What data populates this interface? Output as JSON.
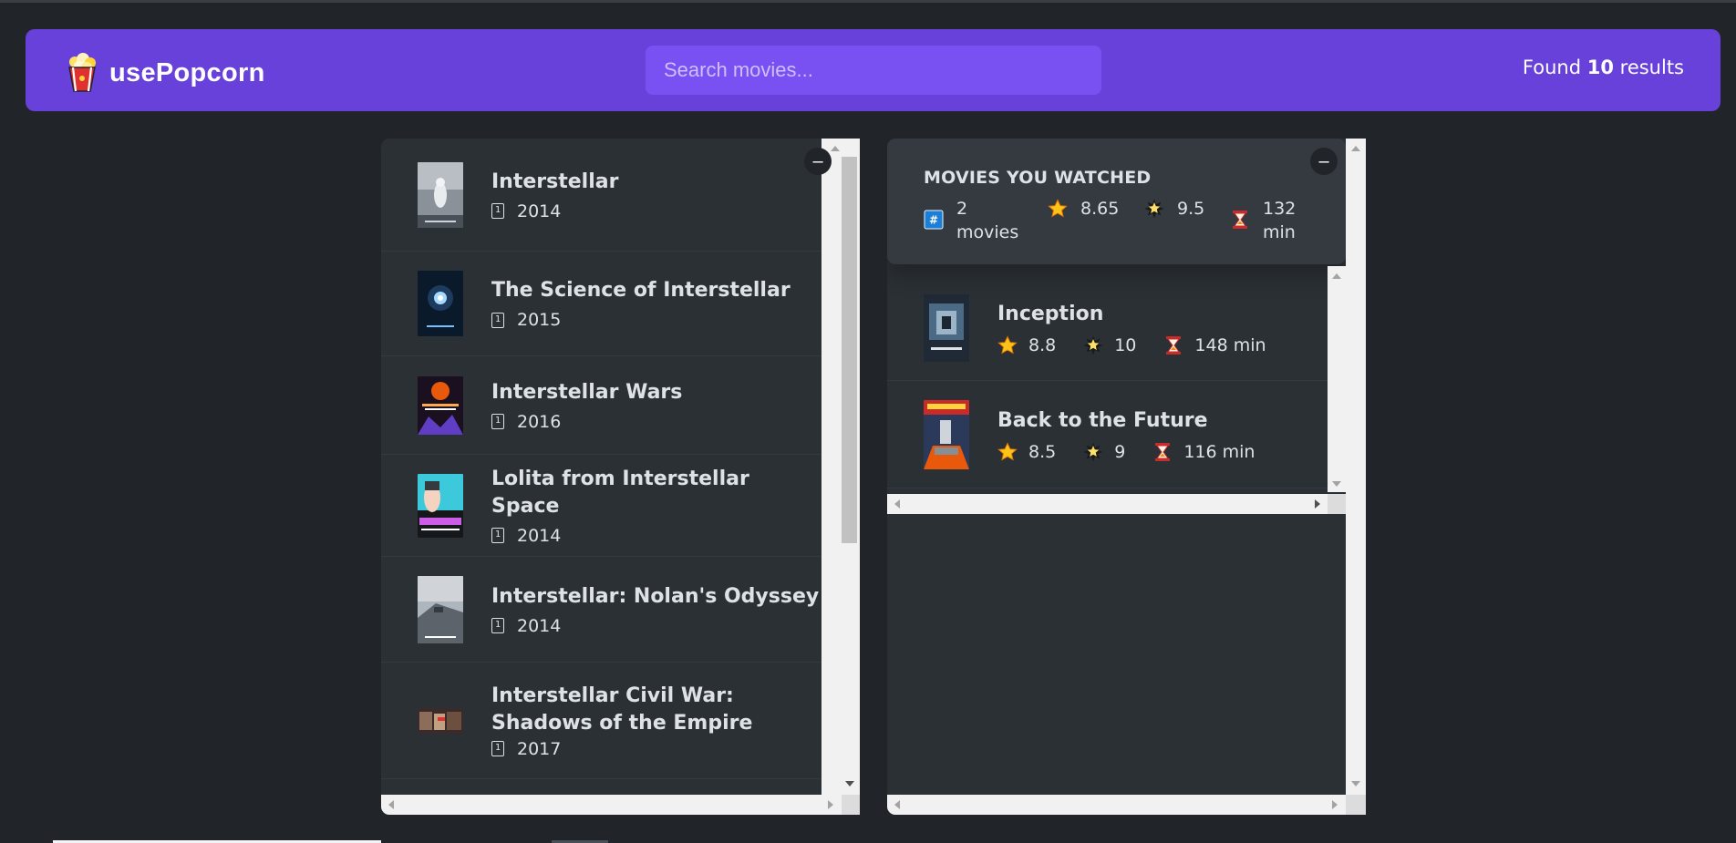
{
  "app": {
    "name": "usePopcorn",
    "logo_icon": "popcorn-icon"
  },
  "search": {
    "placeholder": "Search movies...",
    "value": ""
  },
  "results": {
    "prefix": "Found",
    "count": "10",
    "suffix": "results"
  },
  "search_results": {
    "toggle_label": "–",
    "movies": [
      {
        "title": "Interstellar",
        "year": "2014"
      },
      {
        "title": "The Science of Interstellar",
        "year": "2015"
      },
      {
        "title": "Interstellar Wars",
        "year": "2016"
      },
      {
        "title": "Lolita from Interstellar Space",
        "year": "2014"
      },
      {
        "title": "Interstellar: Nolan's Odyssey",
        "year": "2014"
      },
      {
        "title": "Interstellar Civil War: Shadows of the Empire",
        "year": "2017"
      }
    ],
    "year_icon": "calendar-icon"
  },
  "watched": {
    "toggle_label": "–",
    "summary": {
      "title": "MOVIES YOU WATCHED",
      "num_movies": "2 movies",
      "avg_imdb_rating": "8.65",
      "avg_user_rating": "9.5",
      "avg_runtime": "132 min"
    },
    "movies": [
      {
        "title": "Inception",
        "imdb_rating": "8.8",
        "user_rating": "10",
        "runtime": "148 min"
      },
      {
        "title": "Back to the Future",
        "imdb_rating": "8.5",
        "user_rating": "9",
        "runtime": "116 min"
      }
    ]
  },
  "colors": {
    "primary": "#6741d9",
    "primary_light": "#7950f2",
    "background": "#212529",
    "box": "#2b3035",
    "summary": "#343a40",
    "text": "#dee2e6"
  }
}
